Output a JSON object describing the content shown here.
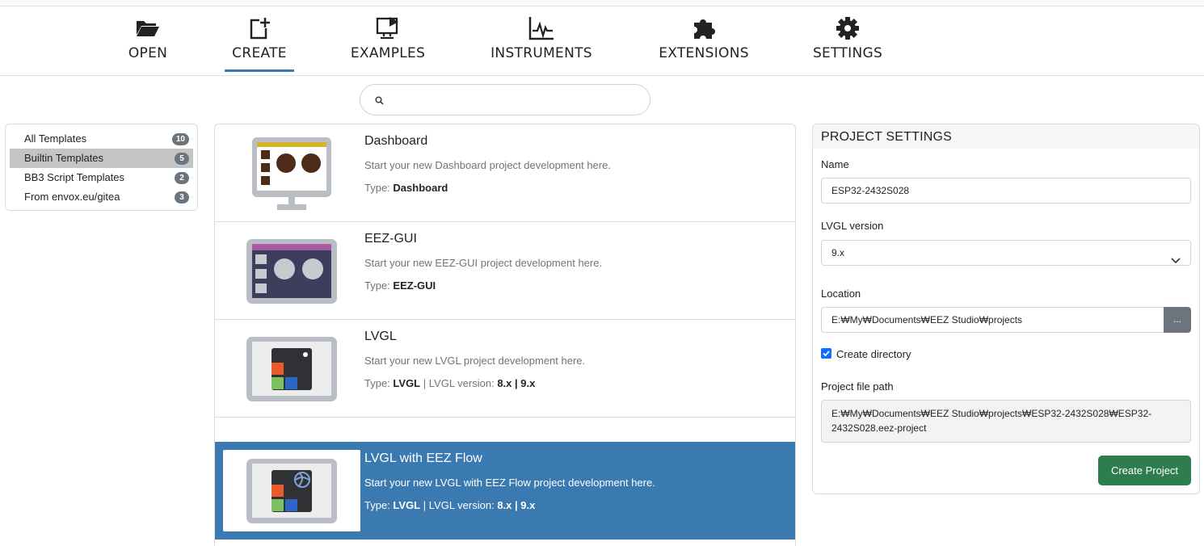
{
  "nav": {
    "items": [
      {
        "label": "OPEN",
        "icon": "folder-open-icon"
      },
      {
        "label": "CREATE",
        "icon": "file-plus-icon"
      },
      {
        "label": "EXAMPLES",
        "icon": "monitor-play-icon"
      },
      {
        "label": "INSTRUMENTS",
        "icon": "chart-pulse-icon"
      },
      {
        "label": "EXTENSIONS",
        "icon": "puzzle-icon"
      },
      {
        "label": "SETTINGS",
        "icon": "gear-icon"
      }
    ],
    "active": "CREATE",
    "accent": "#3a7ab3"
  },
  "search": {
    "value": "",
    "placeholder": ""
  },
  "sidebar": {
    "items": [
      {
        "label": "All Templates",
        "count": "10"
      },
      {
        "label": "Builtin Templates",
        "count": "5"
      },
      {
        "label": "BB3 Script Templates",
        "count": "2"
      },
      {
        "label": "From envox.eu/gitea",
        "count": "3"
      }
    ],
    "active": "Builtin Templates"
  },
  "templates": [
    {
      "title": "Dashboard",
      "description": "Start your new Dashboard project development here.",
      "type_label": "Type:",
      "type": "Dashboard"
    },
    {
      "title": "EEZ-GUI",
      "description": "Start your new EEZ-GUI project development here.",
      "type_label": "Type:",
      "type": "EEZ-GUI"
    },
    {
      "title": "LVGL",
      "description": "Start your new LVGL project development here.",
      "type_label": "Type:",
      "type": "LVGL",
      "sep": "|",
      "version_label": "LVGL version:",
      "version": "8.x | 9.x"
    },
    {
      "title": "LVGL with EEZ Flow",
      "description": "Start your new LVGL with EEZ Flow project development here.",
      "type_label": "Type:",
      "type": "LVGL",
      "sep": "|",
      "version_label": "LVGL version:",
      "version": "8.x | 9.x"
    }
  ],
  "selected_template": "LVGL with EEZ Flow",
  "selected_color": "#3b79b1",
  "settings": {
    "header": "PROJECT SETTINGS",
    "name_label": "Name",
    "name_value": "ESP32-2432S028",
    "lvgl_label": "LVGL version",
    "lvgl_value": "9.x",
    "location_label": "Location",
    "location_value": "E:₩My₩Documents₩EEZ Studio₩projects",
    "browse_label": "...",
    "create_dir_label": "Create directory",
    "create_dir_checked": true,
    "path_label": "Project file path",
    "path_value": "E:₩My₩Documents₩EEZ Studio₩projects₩ESP32-2432S028₩ESP32-2432S028.eez-project",
    "create_button": "Create Project",
    "create_button_color": "#2e7d4f"
  }
}
